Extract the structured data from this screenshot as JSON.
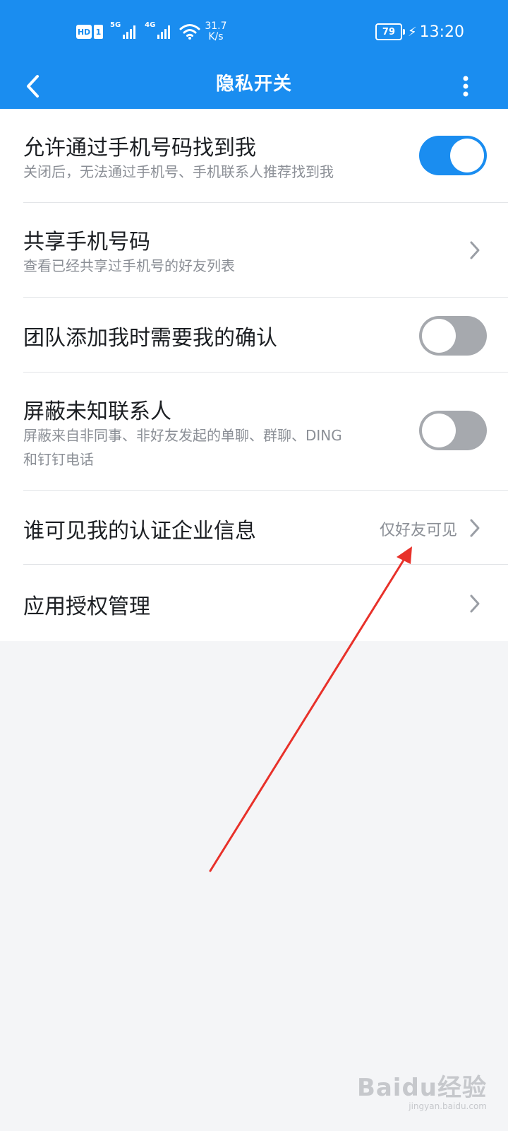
{
  "status_bar": {
    "hd": "HD",
    "sim": "1",
    "network1": "5G",
    "network2": "4G",
    "speed_value": "31.7",
    "speed_unit": "K/s",
    "battery": "79",
    "time": "13:20"
  },
  "header": {
    "title": "隐私开关",
    "back_icon": "chevron-left-icon",
    "more_icon": "more-vertical-icon"
  },
  "settings": [
    {
      "title": "允许通过手机号码找到我",
      "subtitle": "关闭后，无法通过手机号、手机联系人推荐找到我",
      "control": "toggle",
      "toggle_on": true
    },
    {
      "title": "共享手机号码",
      "subtitle": "查看已经共享过手机号的好友列表",
      "control": "chevron"
    },
    {
      "title": "团队添加我时需要我的确认",
      "control": "toggle",
      "toggle_on": false
    },
    {
      "title": "屏蔽未知联系人",
      "subtitle_line1": "屏蔽来自非同事、非好友发起的单聊、群聊、DING",
      "subtitle_line2": "和钉钉电话",
      "control": "toggle",
      "toggle_on": false
    },
    {
      "title": "谁可见我的认证企业信息",
      "value": "仅好友可见",
      "control": "chevron"
    },
    {
      "title": "应用授权管理",
      "control": "chevron"
    }
  ],
  "colors": {
    "accent": "#1a8df0",
    "toggle_off": "#a6a9ae",
    "annotation_arrow": "#e8312a",
    "background": "#f4f5f7"
  },
  "watermark": {
    "main": "Baidu经验",
    "sub": "jingyan.baidu.com"
  }
}
